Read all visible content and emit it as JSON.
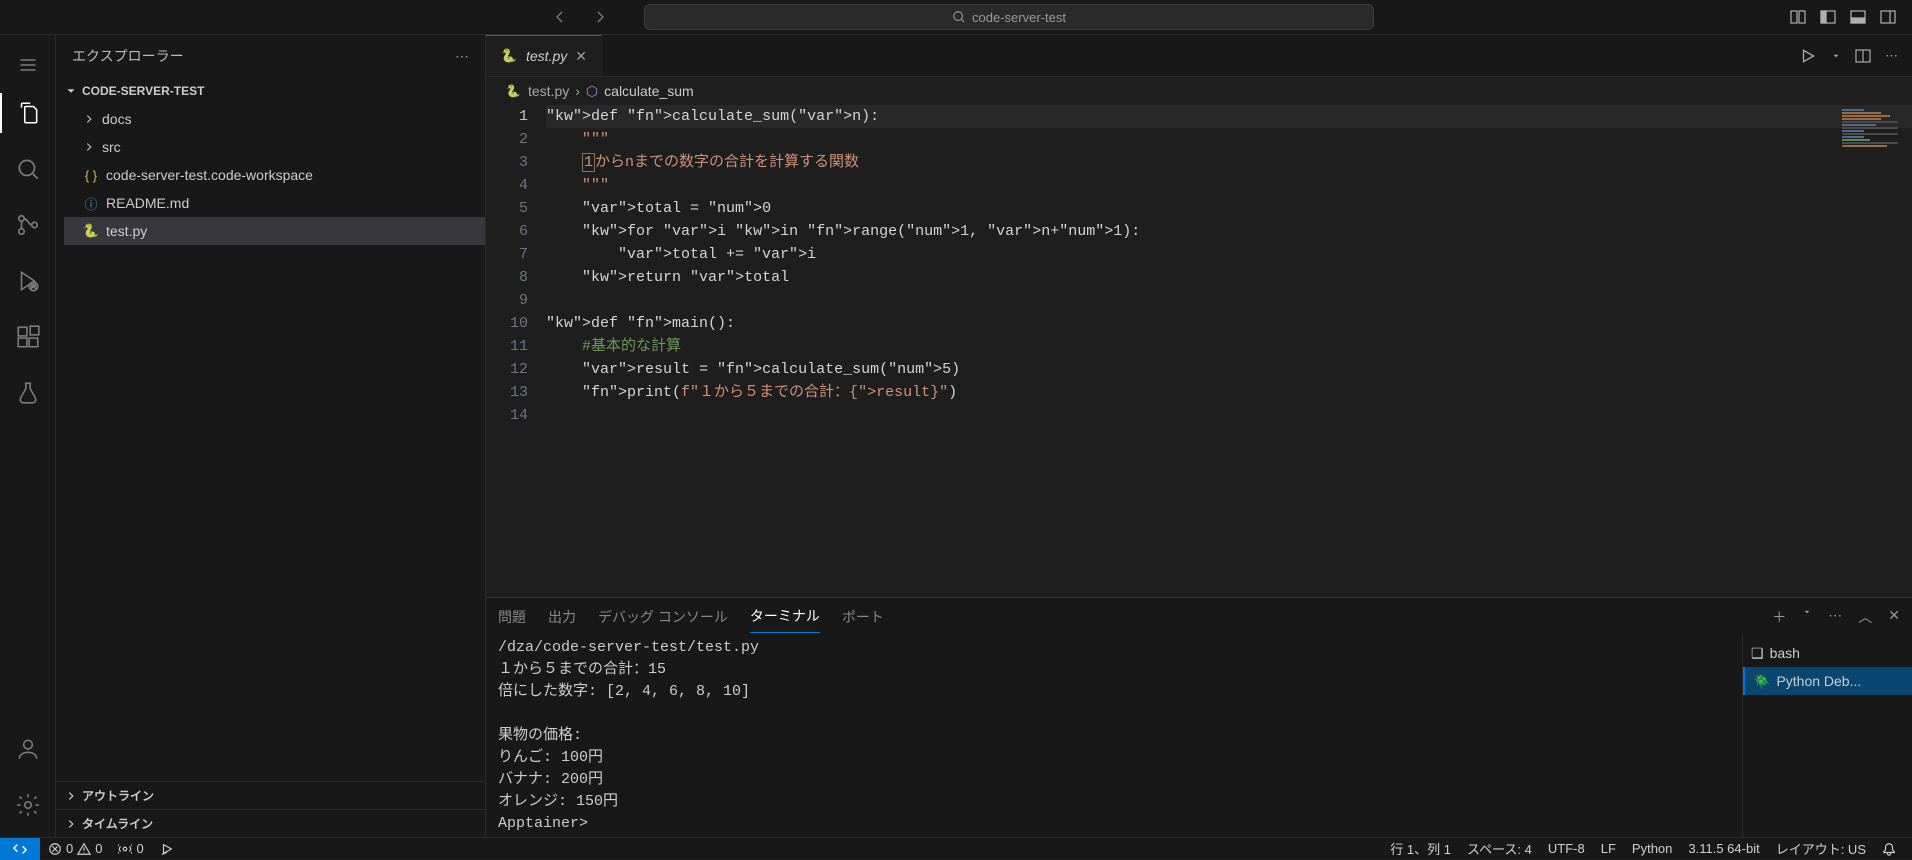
{
  "titlebar": {
    "search_text": "code-server-test"
  },
  "sidebar": {
    "title": "エクスプローラー",
    "folder_name": "CODE-SERVER-TEST",
    "items": [
      {
        "name": "docs",
        "type": "folder"
      },
      {
        "name": "src",
        "type": "folder"
      },
      {
        "name": "code-server-test.code-workspace",
        "type": "json"
      },
      {
        "name": "README.md",
        "type": "info"
      },
      {
        "name": "test.py",
        "type": "python"
      }
    ],
    "outline": "アウトライン",
    "timeline": "タイムライン"
  },
  "tab": {
    "filename": "test.py"
  },
  "breadcrumb": {
    "file": "test.py",
    "symbol": "calculate_sum"
  },
  "code": {
    "lines": [
      "def calculate_sum(n):",
      "    \"\"\"",
      "    1からnまでの数字の合計を計算する関数",
      "    \"\"\"",
      "    total = 0",
      "    for i in range(1, n+1):",
      "        total += i",
      "    return total",
      "",
      "def main():",
      "    #基本的な計算",
      "    result = calculate_sum(5)",
      "    print(f\"１から５までの合計：{result}\")",
      ""
    ]
  },
  "panel": {
    "tabs": {
      "problems": "問題",
      "output": "出力",
      "debug": "デバッグ コンソール",
      "terminal": "ターミナル",
      "ports": "ポート"
    },
    "terminal_lines": [
      "/dza/code-server-test/test.py",
      "１から５までの合計：15",
      "倍にした数字: [2, 4, 6, 8, 10]",
      "",
      "果物の価格:",
      "りんご: 100円",
      "バナナ: 200円",
      "オレンジ: 150円",
      "Apptainer>"
    ],
    "side": {
      "bash": "bash",
      "pydbg": "Python Deb..."
    }
  },
  "status": {
    "errors": "0",
    "warnings": "0",
    "ports": "0",
    "cursor": "行 1、列 1",
    "spaces": "スペース: 4",
    "encoding": "UTF-8",
    "eol": "LF",
    "lang": "Python",
    "runtime": "3.11.5 64-bit",
    "layout": "レイアウト: US"
  }
}
